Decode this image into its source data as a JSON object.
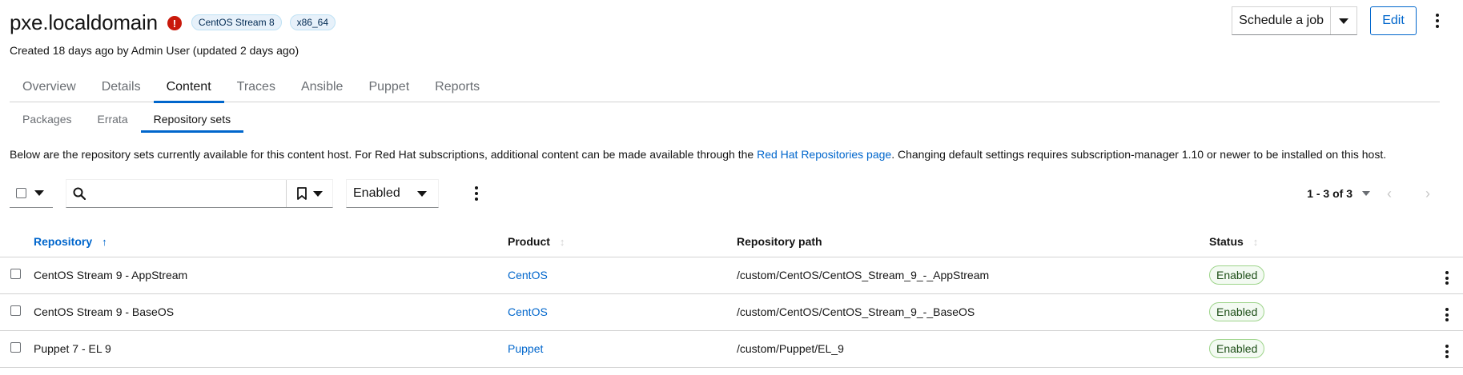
{
  "header": {
    "title": "pxe.localdomain",
    "error_icon": "exclamation-circle-icon",
    "labels": [
      "CentOS Stream 8",
      "x86_64"
    ],
    "created": "Created 18 days ago by Admin User (updated 2 days ago)"
  },
  "actions": {
    "schedule_job": "Schedule a job",
    "edit": "Edit"
  },
  "tabs": [
    {
      "label": "Overview",
      "active": false
    },
    {
      "label": "Details",
      "active": false
    },
    {
      "label": "Content",
      "active": true
    },
    {
      "label": "Traces",
      "active": false
    },
    {
      "label": "Ansible",
      "active": false
    },
    {
      "label": "Puppet",
      "active": false
    },
    {
      "label": "Reports",
      "active": false
    }
  ],
  "subtabs": [
    {
      "label": "Packages",
      "active": false
    },
    {
      "label": "Errata",
      "active": false
    },
    {
      "label": "Repository sets",
      "active": true
    }
  ],
  "description": {
    "before": "Below are the repository sets currently available for this content host. For Red Hat subscriptions, additional content can be made available through the ",
    "link": "Red Hat Repositories page",
    "after": ". Changing default settings requires subscription-manager 1.10 or newer to be installed on this host."
  },
  "toolbar": {
    "search_placeholder": "",
    "filter_value": "Enabled",
    "pagination": "1 - 3 of 3"
  },
  "table": {
    "columns": [
      "Repository",
      "Product",
      "Repository path",
      "Status"
    ],
    "rows": [
      {
        "repository": "CentOS Stream 9 - AppStream",
        "product": "CentOS",
        "path": "/custom/CentOS/CentOS_Stream_9_-_AppStream",
        "status": "Enabled"
      },
      {
        "repository": "CentOS Stream 9 - BaseOS",
        "product": "CentOS",
        "path": "/custom/CentOS/CentOS_Stream_9_-_BaseOS",
        "status": "Enabled"
      },
      {
        "repository": "Puppet 7 - EL 9",
        "product": "Puppet",
        "path": "/custom/Puppet/EL_9",
        "status": "Enabled"
      }
    ]
  },
  "colors": {
    "accent": "#0066cc",
    "error": "#c9190b",
    "success_bg": "#f3faf2"
  }
}
